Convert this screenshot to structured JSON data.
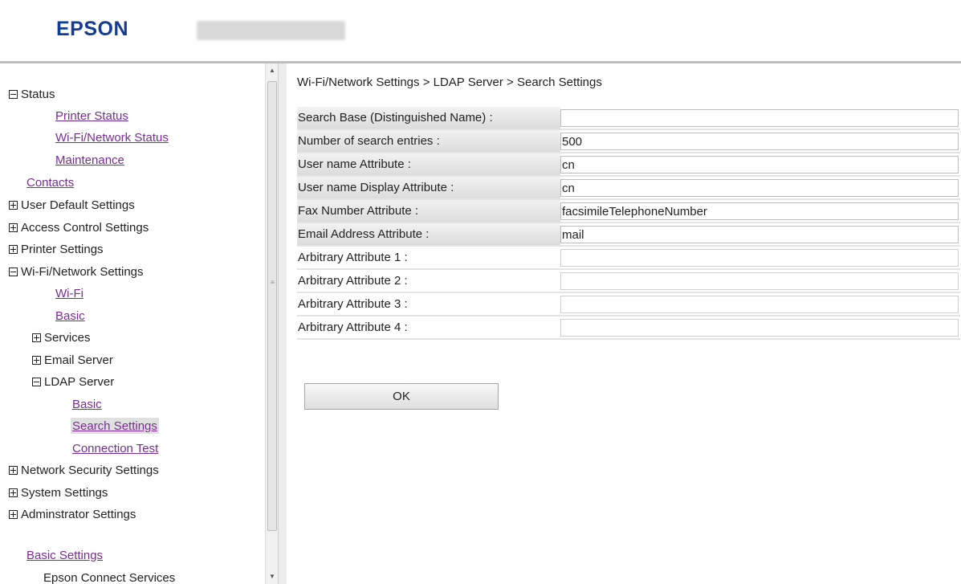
{
  "header": {
    "logo": "EPSON"
  },
  "sidebar": {
    "items": [
      {
        "label": "Status",
        "type": "toggle",
        "state": "minus",
        "level": 0
      },
      {
        "label": "Printer Status",
        "type": "link",
        "level": 2
      },
      {
        "label": "Wi-Fi/Network Status",
        "type": "link",
        "level": 2
      },
      {
        "label": "Maintenance",
        "type": "link",
        "level": 2
      },
      {
        "label": "Contacts",
        "type": "link",
        "level": 1
      },
      {
        "label": "User Default Settings",
        "type": "toggle",
        "state": "plus",
        "level": 0
      },
      {
        "label": "Access Control Settings",
        "type": "toggle",
        "state": "plus",
        "level": 0
      },
      {
        "label": "Printer Settings",
        "type": "toggle",
        "state": "plus",
        "level": 0
      },
      {
        "label": "Wi-Fi/Network Settings",
        "type": "toggle",
        "state": "minus",
        "level": 0
      },
      {
        "label": "Wi-Fi",
        "type": "link",
        "level": 2
      },
      {
        "label": "Basic",
        "type": "link",
        "level": 2
      },
      {
        "label": "Services",
        "type": "toggle",
        "state": "plus",
        "level": 1
      },
      {
        "label": "Email Server",
        "type": "toggle",
        "state": "plus",
        "level": 1
      },
      {
        "label": "LDAP Server",
        "type": "toggle",
        "state": "minus",
        "level": 1
      },
      {
        "label": "Basic",
        "type": "link",
        "level": 3
      },
      {
        "label": "Search Settings",
        "type": "link",
        "level": 3,
        "active": true
      },
      {
        "label": "Connection Test",
        "type": "link",
        "level": 3
      },
      {
        "label": "Network Security Settings",
        "type": "toggle",
        "state": "plus",
        "level": 0
      },
      {
        "label": "System Settings",
        "type": "toggle",
        "state": "plus",
        "level": 0
      },
      {
        "label": "Adminstrator Settings",
        "type": "toggle",
        "state": "plus",
        "level": 0
      },
      {
        "label": "Basic Settings",
        "type": "link",
        "level": 0
      },
      {
        "label": "Epson Connect Services",
        "type": "text",
        "level": 1
      }
    ]
  },
  "main": {
    "breadcrumb": "Wi-Fi/Network Settings > LDAP Server > Search Settings",
    "fields": [
      {
        "label": "Search Base (Distinguished Name) :",
        "value": ""
      },
      {
        "label": "Number of search entries :",
        "value": "500"
      },
      {
        "label": "User name Attribute :",
        "value": "cn"
      },
      {
        "label": "User name Display Attribute :",
        "value": "cn"
      },
      {
        "label": "Fax Number Attribute :",
        "value": "facsimileTelephoneNumber"
      },
      {
        "label": "Email Address Attribute :",
        "value": "mail"
      },
      {
        "label": "Arbitrary Attribute 1 :",
        "value": ""
      },
      {
        "label": "Arbitrary Attribute 2 :",
        "value": ""
      },
      {
        "label": "Arbitrary Attribute 3 :",
        "value": ""
      },
      {
        "label": "Arbitrary Attribute 4 :",
        "value": ""
      }
    ],
    "ok_label": "OK"
  },
  "colors": {
    "logo": "#123c96",
    "link": "#7a2c96",
    "label_band": "#e4e4e4"
  }
}
